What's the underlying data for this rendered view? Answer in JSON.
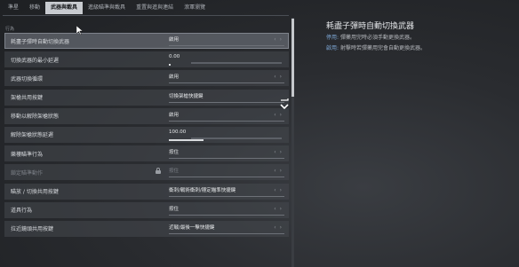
{
  "tabs": [
    {
      "label": "準星",
      "active": false
    },
    {
      "label": "移動",
      "active": false
    },
    {
      "label": "武器與載具",
      "active": true
    },
    {
      "label": "進級瞄準與載具",
      "active": false
    },
    {
      "label": "重置與進與連結",
      "active": false
    },
    {
      "label": "滾軍瀏覽",
      "active": false
    }
  ],
  "section_label": "行為",
  "rows": [
    {
      "label": "耗盡子彈時自動切換武器",
      "value": "啟用",
      "kind": "toggle",
      "highlight": true
    },
    {
      "label": "切換武器的最小延遲",
      "value": "0.00",
      "kind": "slider",
      "fill": 0.0
    },
    {
      "label": "武器切換循環",
      "value": "啟用",
      "kind": "toggle"
    },
    {
      "label": "架槍共用按鍵",
      "value": "切換架槍快捷鍵",
      "kind": "dropdown"
    },
    {
      "label": "移動以解除架槍狀態",
      "value": "啟用",
      "kind": "toggle"
    },
    {
      "label": "解除架槍狀態延遲",
      "value": "100.00",
      "kind": "slider",
      "fill": 0.3
    },
    {
      "label": "樂樓瞄準行為",
      "value": "按住",
      "kind": "toggle"
    },
    {
      "label": "鎖定瞄準動作",
      "value": "按住",
      "kind": "locked",
      "disabled": true
    },
    {
      "label": "瞄放 / 切換共用按鍵",
      "value": "衝刺/戰術衝刺/穩定瞄準快捷鍵",
      "kind": "toggle"
    },
    {
      "label": "道具行為",
      "value": "按住",
      "kind": "toggle"
    },
    {
      "label": "拉近鏡頭共用按鍵",
      "value": "近戰/最後一擊快捷鍵",
      "kind": "toggle"
    }
  ],
  "detail": {
    "title": "耗盡子彈時自動切換武器",
    "lines": [
      {
        "key": "停用:",
        "text": "彈藥用完時必須手動更換武器。"
      },
      {
        "key": "啟用:",
        "text": "射擊時若彈藥用完會自動更換武器。"
      }
    ]
  },
  "colors": {
    "accent": "#7ea8d6",
    "active_tab": "#c8cbd0"
  },
  "icons": {
    "cursor": "mouse-cursor-icon",
    "lock": "lock-icon",
    "chevron": "chevron-down-icon",
    "arrows": "arrow-left-right-icon"
  }
}
